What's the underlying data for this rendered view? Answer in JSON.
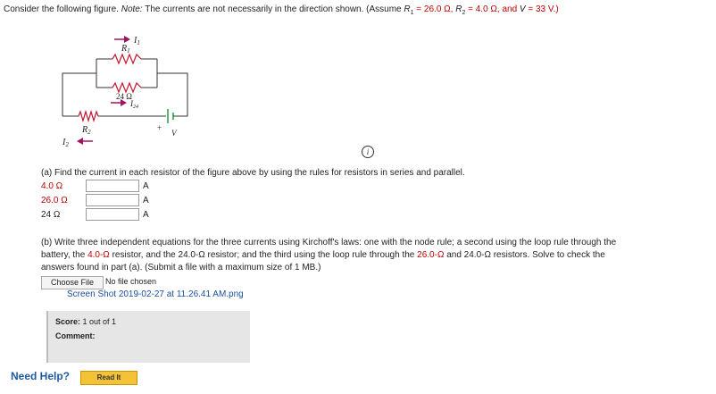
{
  "question": {
    "intro_part1": "Consider the following figure. ",
    "note": "Note:",
    "intro_part2": " The currents are not necessarily in the direction shown. (Assume ",
    "r1_sym": "R",
    "r1_sub": "1",
    "r1_val": " = 26.0 Ω, ",
    "r2_sym": "R",
    "r2_sub": "2",
    "r2_val": " = 4.0 Ω, and ",
    "v_sym": "V",
    "v_val": " = 33 V.)"
  },
  "circuit": {
    "label_i1": "I",
    "label_i1_sub": "1",
    "label_r1": "R",
    "label_r1_sub": "1",
    "label_24": "24 Ω",
    "label_i24": "I",
    "label_i24_sub": "24",
    "label_r2": "R",
    "label_r2_sub": "2",
    "label_i2": "I",
    "label_i2_sub": "2",
    "label_plus": "+",
    "label_v": "V",
    "info_icon": "i"
  },
  "part_a": {
    "prompt": "(a) Find the current in each resistor of the figure above by using the rules for resistors in series and parallel.",
    "rows": [
      {
        "label": "4.0 Ω",
        "unit": "A",
        "value": ""
      },
      {
        "label": "26.0 Ω",
        "unit": "A",
        "value": ""
      },
      {
        "label": "24 Ω",
        "unit": "A",
        "value": ""
      }
    ]
  },
  "part_b": {
    "p1": "(b) Write three independent equations for the three currents using Kirchoff's laws: one with the node rule; a second using the loop rule through the",
    "p2a": "battery, the ",
    "p2b": "4.0-Ω",
    "p2c": " resistor, and the 24.0-Ω resistor; and the third using the loop rule through the ",
    "p2d": "26.0-Ω",
    "p2e": " and 24.0-Ω resistors. Solve to check the",
    "p3": "answers found in part (a). (Submit a file with a maximum size of 1 MB.)"
  },
  "upload": {
    "choose_label": "Choose File",
    "no_file": "No file chosen",
    "file_name": "Screen Shot 2019-02-27 at 11.26.41 AM.png"
  },
  "score": {
    "score_label": "Score:",
    "score_value": "1 out of 1",
    "comment_label": "Comment:"
  },
  "help": {
    "need_help": "Need Help?",
    "read_it": "Read It"
  },
  "colors": {
    "red": "#c00000",
    "blue": "#1a4f9e",
    "arrow": "#a0145f",
    "battery": "#1f9e3c"
  }
}
